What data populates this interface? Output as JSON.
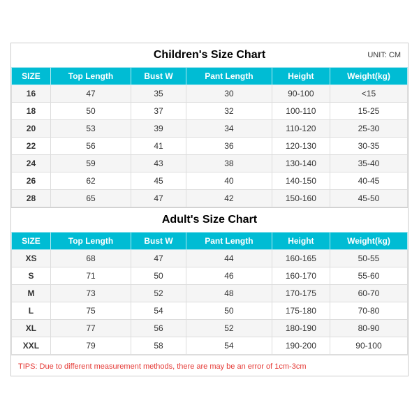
{
  "children_title": "Children's Size Chart",
  "adult_title": "Adult's Size Chart",
  "unit_label": "UNIT: CM",
  "headers": [
    "SIZE",
    "Top Length",
    "Bust W",
    "Pant Length",
    "Height",
    "Weight(kg)"
  ],
  "children_rows": [
    [
      "16",
      "47",
      "35",
      "30",
      "90-100",
      "<15"
    ],
    [
      "18",
      "50",
      "37",
      "32",
      "100-110",
      "15-25"
    ],
    [
      "20",
      "53",
      "39",
      "34",
      "110-120",
      "25-30"
    ],
    [
      "22",
      "56",
      "41",
      "36",
      "120-130",
      "30-35"
    ],
    [
      "24",
      "59",
      "43",
      "38",
      "130-140",
      "35-40"
    ],
    [
      "26",
      "62",
      "45",
      "40",
      "140-150",
      "40-45"
    ],
    [
      "28",
      "65",
      "47",
      "42",
      "150-160",
      "45-50"
    ]
  ],
  "adult_rows": [
    [
      "XS",
      "68",
      "47",
      "44",
      "160-165",
      "50-55"
    ],
    [
      "S",
      "71",
      "50",
      "46",
      "160-170",
      "55-60"
    ],
    [
      "M",
      "73",
      "52",
      "48",
      "170-175",
      "60-70"
    ],
    [
      "L",
      "75",
      "54",
      "50",
      "175-180",
      "70-80"
    ],
    [
      "XL",
      "77",
      "56",
      "52",
      "180-190",
      "80-90"
    ],
    [
      "XXL",
      "79",
      "58",
      "54",
      "190-200",
      "90-100"
    ]
  ],
  "tips_text": "TIPS: Due to different measurement methods, there are may be an error of 1cm-3cm"
}
